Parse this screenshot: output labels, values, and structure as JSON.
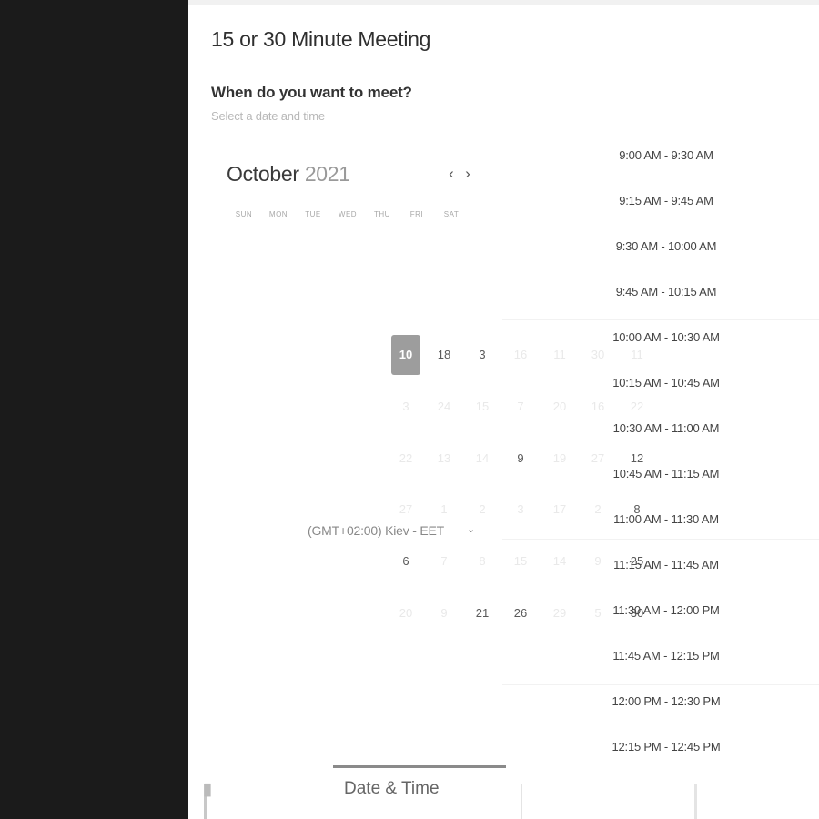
{
  "title": "15 or 30 Minute Meeting",
  "question": "When do you want to meet?",
  "subtitle": "Select a date and time",
  "calendar": {
    "month": "October",
    "year": "2021",
    "prev_icon": "chevron-left-icon",
    "next_icon": "chevron-right-icon",
    "weekdays": [
      "SUN",
      "MON",
      "TUE",
      "WED",
      "THU",
      "FRI",
      "SAT"
    ],
    "selected_day": "10",
    "days": [
      "10",
      "18",
      "3",
      "16",
      "11",
      "30",
      "11",
      "3",
      "24",
      "15",
      "7",
      "20",
      "16",
      "22",
      "22",
      "13",
      "14",
      "9",
      "19",
      "27",
      "12",
      "27",
      "1",
      "2",
      "3",
      "17",
      "2",
      "8",
      "6",
      "7",
      "8",
      "15",
      "14",
      "9",
      "25",
      "20",
      "9",
      "21",
      "26",
      "29",
      "5",
      "30"
    ],
    "available_days": [
      "10",
      "18",
      "3",
      "9",
      "12",
      "17",
      "8",
      "6",
      "25",
      "21",
      "26",
      "30"
    ]
  },
  "timezone": {
    "label": "(GMT+02:00) Kiev - EET",
    "chevron_icon": "chevron-down-icon"
  },
  "time_slots": [
    "9:00 AM - 9:30 AM",
    "9:15 AM - 9:45 AM",
    "9:30 AM - 10:00 AM",
    "9:45 AM - 10:15 AM",
    "10:00 AM - 10:30 AM",
    "10:15 AM - 10:45 AM",
    "10:30 AM - 11:00 AM",
    "10:45 AM - 11:15 AM",
    "11:00 AM - 11:30 AM",
    "11:15 AM - 11:45 AM",
    "11:30 AM - 12:00 PM",
    "11:45 AM - 12:15 PM",
    "12:00 PM - 12:30 PM",
    "12:15 PM - 12:45 PM"
  ],
  "tabs": {
    "active": "Date & Time",
    "details_icon": "calendar-icon"
  },
  "colors": {
    "background": "#1b1b1b",
    "panel": "#ffffff",
    "selected_day": "#9d9d9d"
  }
}
